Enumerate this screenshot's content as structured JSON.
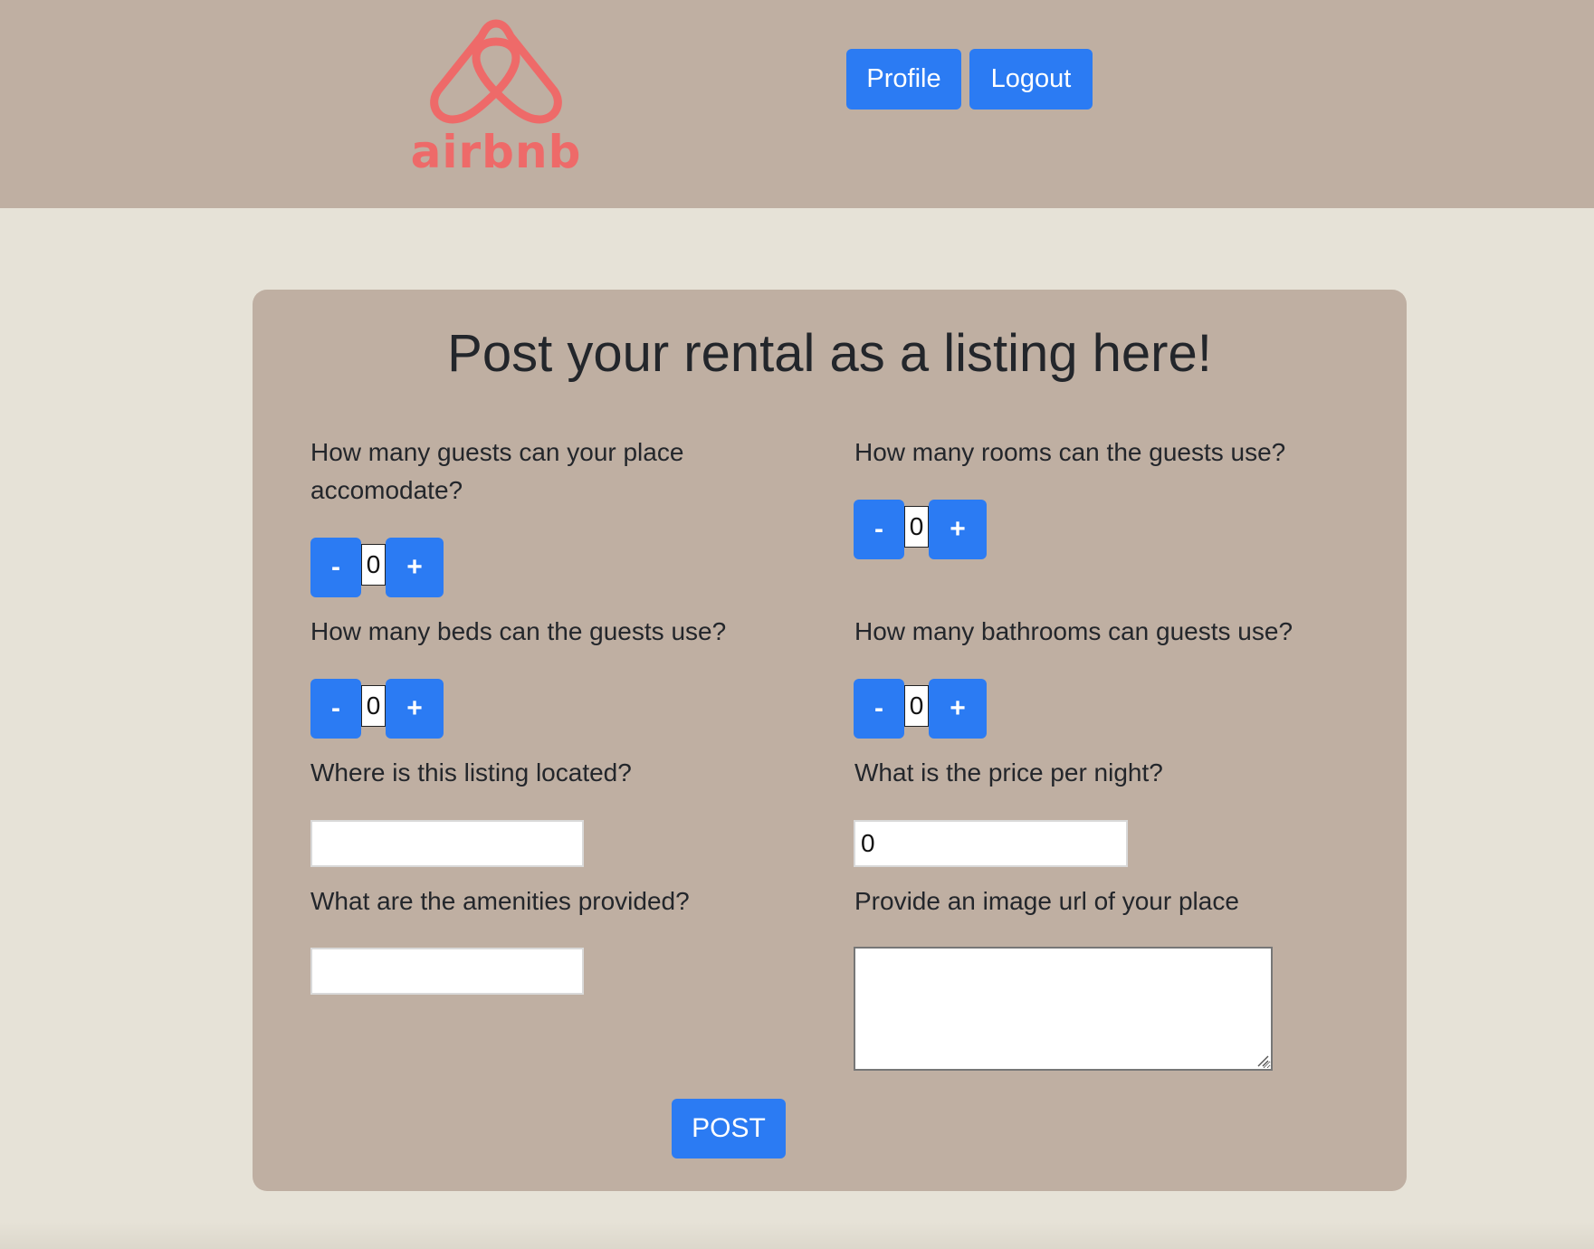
{
  "header": {
    "logo_text": "airbnb",
    "logo_icon": "airbnb-belo-icon",
    "profile_label": "Profile",
    "logout_label": "Logout"
  },
  "form": {
    "title": "Post your rental as a listing here!",
    "guests": {
      "question": "How many guests can your place accomodate?",
      "value": "0",
      "minus": "-",
      "plus": "+"
    },
    "rooms": {
      "question": "How many rooms can the guests use?",
      "value": "0",
      "minus": "-",
      "plus": "+"
    },
    "beds": {
      "question": "How many beds can the guests use?",
      "value": "0",
      "minus": "-",
      "plus": "+"
    },
    "bathrooms": {
      "question": "How many bathrooms can guests use?",
      "value": "0",
      "minus": "-",
      "plus": "+"
    },
    "location": {
      "question": "Where is this listing located?",
      "value": ""
    },
    "price": {
      "question": "What is the price per night?",
      "value": "0"
    },
    "amenities": {
      "question": "What are the amenities provided?",
      "value": ""
    },
    "image_url": {
      "question": "Provide an image url of your place",
      "value": ""
    },
    "post_label": "POST"
  },
  "colors": {
    "header_bg": "#bfafa2",
    "page_bg": "#e6e2d7",
    "card_bg": "#bfafa2",
    "button_blue": "#2b7bf3",
    "brand_coral": "#ee6a69"
  }
}
